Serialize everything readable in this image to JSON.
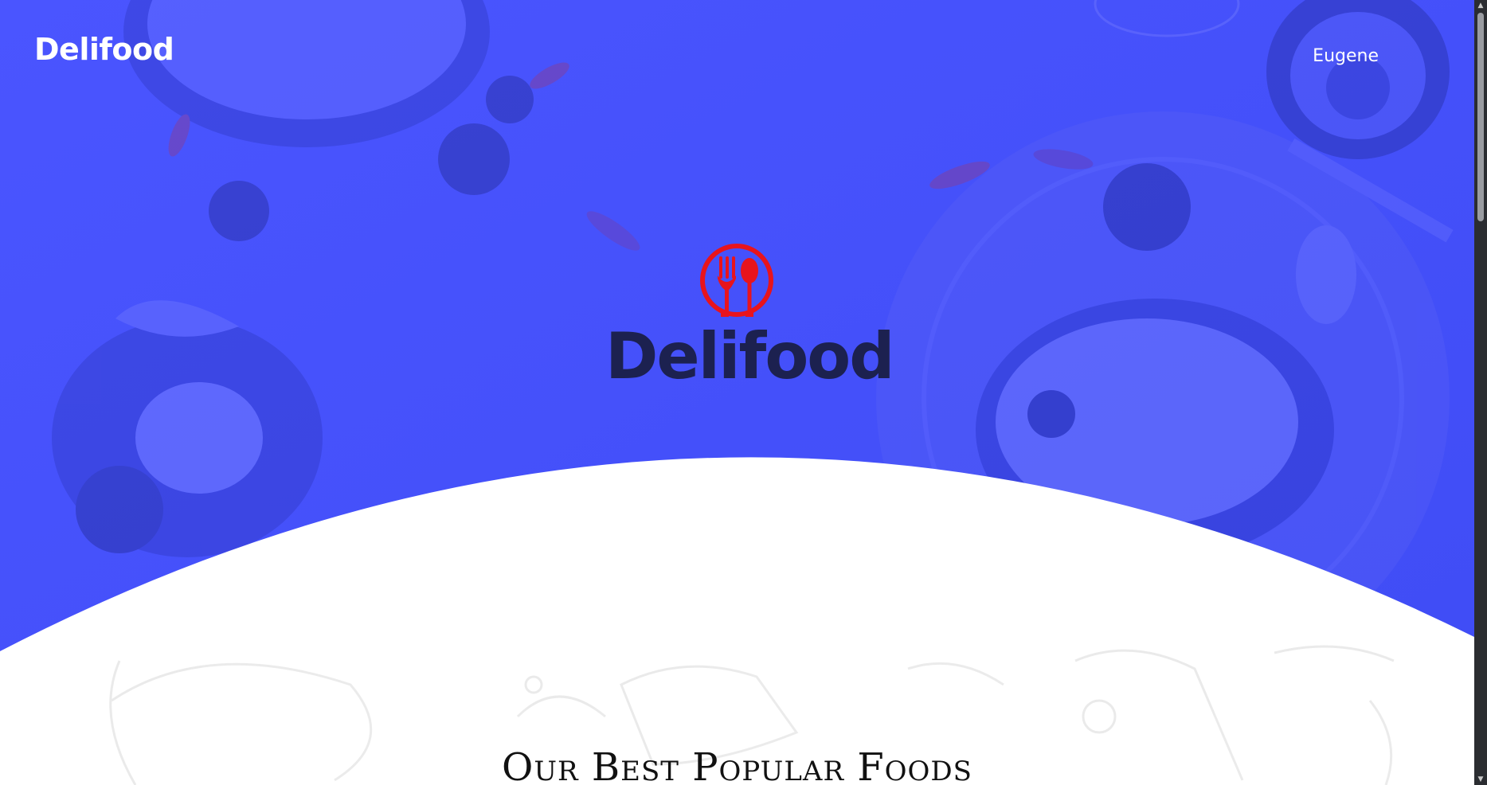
{
  "navbar": {
    "brand": "Delifood",
    "user_name": "Eugene"
  },
  "hero": {
    "logo_wordmark": "Delifood",
    "logo_icon": "fork-spoon-plate-icon",
    "overlay_color": "#4650ff",
    "logo_icon_color": "#e8141c",
    "wordmark_color": "#1c2150"
  },
  "popular": {
    "title": "Our Best Popular Foods"
  },
  "scrollbar": {
    "up_icon": "chevron-up-icon",
    "down_icon": "chevron-down-icon"
  }
}
